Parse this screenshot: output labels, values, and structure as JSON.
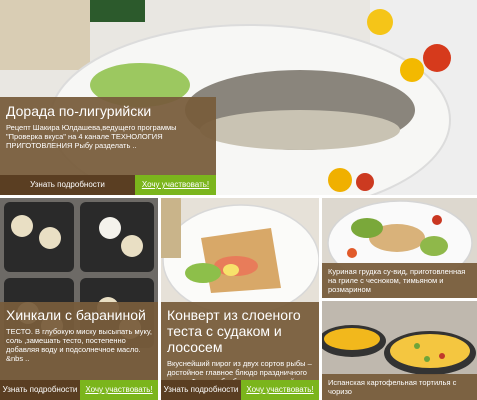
{
  "tiles": {
    "dorada": {
      "title": "Дорада по-лигурийски",
      "description": "Рецепт Шакира Юлдашева,ведущего программы \"Проверка вкуса\" на 4 канале ТЕХНОЛОГИЯ ПРИГОТОВЛЕНИЯ Рыбу разделать ..",
      "more_label": "Узнать подробности",
      "join_label": "Хочу участвовать!"
    },
    "khinkali": {
      "title": "Хинкали с бараниной",
      "description": "ТЕСТО. В глубокую миску высыпать муку, соль ,замешать тесто, постепенно добавляя воду и подсолнечное масло. &nbs ..",
      "more_label": "Узнать подробности",
      "join_label": "Хочу участвовать!"
    },
    "konvert": {
      "title": "Конверт из слоеного теста с судаком и лососем",
      "description": "Вкуснейший пирог из двух сортов рыбы – достойное главное блюдо праздничного стола. Филе рыбы без кожи и костей ..",
      "more_label": "Узнать подробности",
      "join_label": "Хочу участвовать!"
    },
    "chicken": {
      "caption": "Куриная грудка су-вид, приготовленная на гриле с чесноком, тимьяном и розмарином"
    },
    "tortilla": {
      "caption": "Испанская картофельная тортилья с чоризо"
    }
  },
  "colors": {
    "panel": "#785c3c",
    "button_dark": "#5a3e22",
    "button_green": "#7bb51c"
  }
}
